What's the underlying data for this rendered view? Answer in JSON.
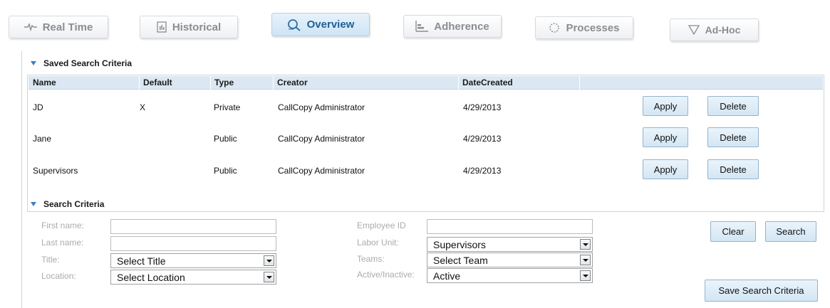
{
  "tabs": [
    {
      "label": "Real Time",
      "icon": "pulse-icon",
      "active": false
    },
    {
      "label": "Historical",
      "icon": "report-icon",
      "active": false
    },
    {
      "label": "Overview",
      "icon": "magnifier-icon",
      "active": true
    },
    {
      "label": "Adherence",
      "icon": "bar-chart-icon",
      "active": false
    },
    {
      "label": "Processes",
      "icon": "spinner-icon",
      "active": false
    },
    {
      "label": "Ad-Hoc",
      "icon": "funnel-icon",
      "active": false
    }
  ],
  "saved_search": {
    "title": "Saved Search Criteria",
    "columns": [
      "Name",
      "Default",
      "Type",
      "Creator",
      "DateCreated"
    ],
    "rows": [
      {
        "name": "JD",
        "default": "X",
        "type": "Private",
        "creator": "CallCopy Administrator",
        "date_created": "4/29/2013"
      },
      {
        "name": "Jane",
        "default": "",
        "type": "Public",
        "creator": "CallCopy Administrator",
        "date_created": "4/29/2013"
      },
      {
        "name": "Supervisors",
        "default": "",
        "type": "Public",
        "creator": "CallCopy Administrator",
        "date_created": "4/29/2013"
      }
    ],
    "apply_label": "Apply",
    "delete_label": "Delete"
  },
  "search_criteria": {
    "title": "Search Criteria",
    "first_name_label": "First name:",
    "first_name_value": "",
    "last_name_label": "Last name:",
    "last_name_value": "",
    "title_label": "Title:",
    "title_value": "Select Title",
    "location_label": "Location:",
    "location_value": "Select Location",
    "employee_id_label": "Employee ID",
    "employee_id_value": "",
    "labor_unit_label": "Labor Unit:",
    "labor_unit_value": "Supervisors",
    "teams_label": "Teams:",
    "teams_value": "Select Team",
    "active_label": "Active/Inactive:",
    "active_value": "Active",
    "clear_label": "Clear",
    "search_label": "Search",
    "save_label": "Save Search Criteria"
  },
  "colors": {
    "accent": "#3c7fc0",
    "header_bg": "#dbe8f3",
    "active_tab_text": "#1f5f96",
    "muted_label": "#a8abaf"
  }
}
